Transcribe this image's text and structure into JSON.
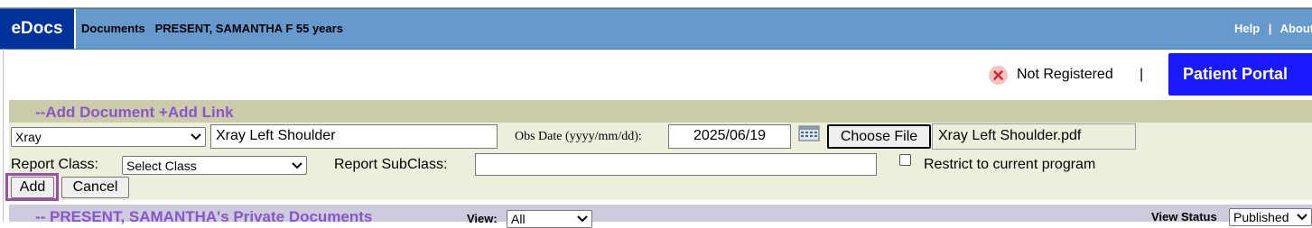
{
  "header": {
    "brand": "eDocs",
    "title": "Documents   PRESENT, SAMANTHA F 55 years",
    "help": "Help",
    "separator": "|",
    "about": "About"
  },
  "registration": {
    "icon": "x-circle-icon",
    "status": "Not Registered",
    "separator": "|",
    "portal_button": "Patient Portal"
  },
  "add_form": {
    "heading": "--Add Document +Add Link",
    "doc_type": {
      "selected": "Xray"
    },
    "description_value": "Xray Left Shoulder",
    "obs_date_label": "Obs Date (yyyy/mm/dd):",
    "obs_date_value": "2025/06/19",
    "calendar_icon": "calendar-icon",
    "choose_file_label": "Choose File",
    "chosen_file": "Xray Left Shoulder.pdf",
    "report_class_label": "Report Class:",
    "report_class_selected": "Select Class",
    "report_subclass_label": "Report SubClass:",
    "report_subclass_value": "",
    "restrict_label": "Restrict to current program",
    "restrict_checked": false,
    "add_button": "Add",
    "cancel_button": "Cancel"
  },
  "private_docs": {
    "heading": "-- PRESENT, SAMANTHA's Private Documents",
    "view_label": "View:",
    "view_selected": "All",
    "view_status_label": "View Status",
    "view_status_selected": "Published"
  },
  "colors": {
    "header_bg": "#6699cc",
    "brand_bg": "#003399",
    "portal_bg": "#1a1aff",
    "section_heading": "#8855cc",
    "highlight_border": "#9b4fa8"
  }
}
